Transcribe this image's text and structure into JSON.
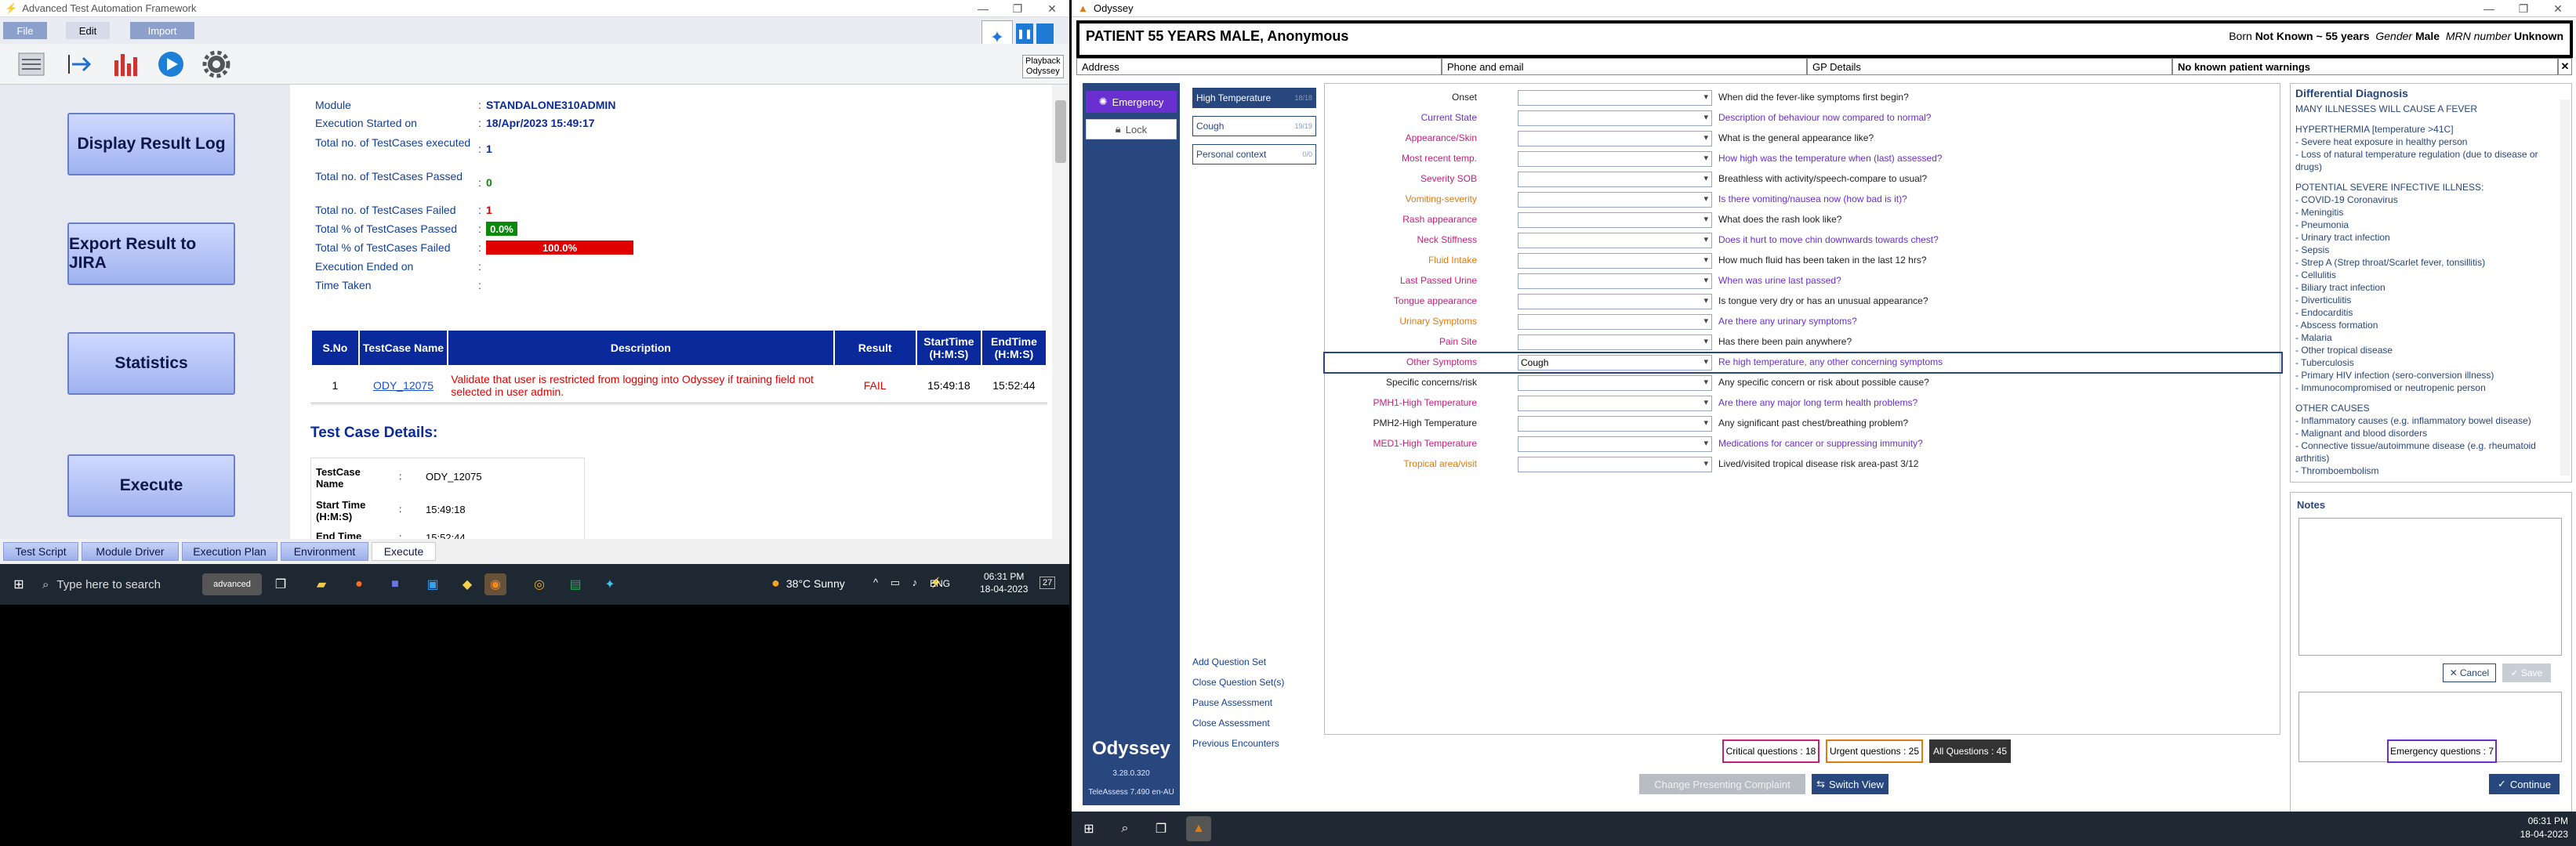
{
  "left": {
    "window_title": "Advanced Test Automation Framework",
    "menu": [
      "File",
      "Edit",
      "Import"
    ],
    "playback": "Playback",
    "playback_app": "Odyssey",
    "buttons": [
      "Display Result Log",
      "Export Result to JIRA",
      "Statistics",
      "Execute"
    ],
    "summary": [
      {
        "label": "Module",
        "value": "STANDALONE310ADMIN"
      },
      {
        "label": "Execution Started on",
        "value": "18/Apr/2023 15:49:17"
      },
      {
        "label": "Total no. of TestCases executed",
        "value": "1"
      },
      {
        "label": "Total no. of TestCases Passed",
        "value": "0"
      },
      {
        "label": "Total no. of TestCases Failed",
        "value": "1"
      },
      {
        "label": "Total % of TestCases Passed",
        "value": "0.0%"
      },
      {
        "label": "Total % of TestCases Failed",
        "value": "100.0%"
      },
      {
        "label": "Execution Ended on",
        "value": ""
      },
      {
        "label": "Time Taken",
        "value": ""
      }
    ],
    "pass_fraction": 0.0,
    "fail_fraction": 1.0,
    "table_headers": [
      "S.No",
      "TestCase Name",
      "Description",
      "Result",
      "StartTime (H:M:S)",
      "EndTime (H:M:S)"
    ],
    "row": {
      "sno": "1",
      "name": "ODY_12075",
      "desc": "Validate that user is restricted from logging into Odyssey if training field not selected in user admin.",
      "result": "FAIL",
      "start": "15:49:18",
      "end": "15:52:44"
    },
    "details_title": "Test Case Details:",
    "details": [
      {
        "label": "TestCase Name",
        "value": "ODY_12075"
      },
      {
        "label": "Start Time (H:M:S)",
        "value": "15:49:18"
      },
      {
        "label": "End Time (H:M:S)",
        "value": "15:52:44"
      }
    ],
    "bottom_tabs": [
      "Test Script",
      "Module Driver",
      "Execution Plan",
      "Environment",
      "Execute"
    ],
    "search_placeholder": "Type here to search",
    "weather": "38°C  Sunny",
    "lang": "ENG",
    "time": "06:31 PM",
    "date": "18-04-2023",
    "notif": "27"
  },
  "right": {
    "window_title": "Odyssey",
    "patient": "PATIENT 55 YEARS MALE, Anonymous",
    "born_label": "Born",
    "born": "Not Known ~ 55 years",
    "gender_label": "Gender",
    "gender": "Male",
    "mrn_label": "MRN number",
    "mrn": "Unknown",
    "address": "Address",
    "phone": "Phone and email",
    "gp": "GP Details",
    "warnings": "No known patient warnings",
    "emergency": "Emergency",
    "lock": "Lock",
    "symptoms": [
      {
        "label": "High Temperature",
        "n": "18/18",
        "active": true
      },
      {
        "label": "Cough",
        "n": "19/19",
        "active": false
      },
      {
        "label": "Personal context",
        "n": "0/0",
        "active": false
      }
    ],
    "questions": [
      {
        "label": "Onset",
        "c": "#222",
        "value": "",
        "text": "When did the fever-like symptoms first begin?",
        "tc": "#222"
      },
      {
        "label": "Current State",
        "c": "#6a2fd1",
        "value": "",
        "text": "Description of behaviour now compared to normal?",
        "tc": "#6a2fd1"
      },
      {
        "label": "Appearance/Skin",
        "c": "#c81e7a",
        "value": "",
        "text": "What is the general appearance like?",
        "tc": "#222"
      },
      {
        "label": "Most recent temp.",
        "c": "#c81e7a",
        "value": "",
        "text": "How high was the temperature when (last) assessed?",
        "tc": "#6a2fd1"
      },
      {
        "label": "Severity SOB",
        "c": "#c81e7a",
        "value": "",
        "text": "Breathless with activity/speech-compare to usual?",
        "tc": "#222"
      },
      {
        "label": "Vomiting-severity",
        "c": "#e07a12",
        "value": "",
        "text": "Is there vomiting/nausea now (how bad is it)?",
        "tc": "#6a2fd1"
      },
      {
        "label": "Rash appearance",
        "c": "#c81e7a",
        "value": "",
        "text": "What does the rash look like?",
        "tc": "#222"
      },
      {
        "label": "Neck Stiffness",
        "c": "#c81e7a",
        "value": "",
        "text": "Does it hurt to move chin downwards towards chest?",
        "tc": "#6a2fd1"
      },
      {
        "label": "Fluid Intake",
        "c": "#e07a12",
        "value": "",
        "text": "How much fluid has been taken in the last 12 hrs?",
        "tc": "#222"
      },
      {
        "label": "Last Passed Urine",
        "c": "#c81e7a",
        "value": "",
        "text": "When was urine last passed?",
        "tc": "#6a2fd1"
      },
      {
        "label": "Tongue appearance",
        "c": "#c81e7a",
        "value": "",
        "text": "Is tongue very dry or has an unusual appearance?",
        "tc": "#222"
      },
      {
        "label": "Urinary Symptoms",
        "c": "#e07a12",
        "value": "",
        "text": "Are there any urinary symptoms?",
        "tc": "#6a2fd1"
      },
      {
        "label": "Pain Site",
        "c": "#c81e7a",
        "value": "",
        "text": "Has there been pain anywhere?",
        "tc": "#222"
      },
      {
        "label": "Other Symptoms",
        "c": "#c81e7a",
        "value": "Cough",
        "text": "Re high temperature, any other concerning symptoms",
        "tc": "#6a2fd1"
      },
      {
        "label": "Specific concerns/risk",
        "c": "#222",
        "value": "",
        "text": "Any specific concern or risk about possible cause?",
        "tc": "#222"
      },
      {
        "label": "PMH1-High Temperature",
        "c": "#c81e7a",
        "value": "",
        "text": "Are there any major long term health problems?",
        "tc": "#6a2fd1"
      },
      {
        "label": "PMH2-High Temperature",
        "c": "#222",
        "value": "",
        "text": "Any significant past chest/breathing problem?",
        "tc": "#222"
      },
      {
        "label": "MED1-High Temperature",
        "c": "#c81e7a",
        "value": "",
        "text": "Medications for cancer or suppressing immunity?",
        "tc": "#6a2fd1"
      },
      {
        "label": "Tropical area/visit",
        "c": "#e07a12",
        "value": "",
        "text": "Lived/visited tropical disease risk area-past 3/12",
        "tc": "#222"
      }
    ],
    "links": [
      "Add Question Set",
      "Close Question Set(s)",
      "Pause Assessment",
      "Close Assessment",
      "Previous Encounters"
    ],
    "brand": "Odyssey",
    "version": "3.28.0.320",
    "teleassess": "TeleAssess 7.490 en-AU",
    "ddx_title": "Differential Diagnosis",
    "ddx": [
      "MANY ILLNESSES WILL CAUSE A FEVER",
      "",
      "HYPERTHERMIA [temperature >41C]",
      "- Severe heat exposure in healthy person",
      "- Loss of natural temperature regulation (due to disease or drugs)",
      "",
      "POTENTIAL SEVERE INFECTIVE ILLNESS:",
      "- COVID-19 Coronavirus",
      "- Meningitis",
      "- Pneumonia",
      "- Urinary tract infection",
      "- Sepsis",
      "- Strep A (Strep throat/Scarlet fever, tonsillitis)",
      "- Cellulitis",
      "- Biliary tract infection",
      "- Diverticulitis",
      "- Endocarditis",
      "- Abscess formation",
      "- Malaria",
      "- Other tropical disease",
      "- Tuberculosis",
      "- Primary HIV infection (sero-conversion illness)",
      "- Immunocompromised or neutropenic person",
      "",
      "OTHER CAUSES",
      "- Inflammatory causes (e.g. inflammatory bowel disease)",
      "- Malignant and blood disorders",
      "- Connective tissue/autoimmune disease (e.g. rheumatoid arthritis)",
      "- Thromboembolism"
    ],
    "notes": "Notes",
    "cancel": "Cancel",
    "save": "Save",
    "counts": [
      {
        "label": "Emergency questions : 7",
        "c": "#6a2fd1"
      },
      {
        "label": "Critical questions : 18",
        "c": "#c81e7a"
      },
      {
        "label": "Urgent questions : 25",
        "c": "#e07a12"
      },
      {
        "label": "All Questions : 45",
        "c": "#222"
      }
    ],
    "change": "Change Presenting Complaint",
    "switch": "Switch View",
    "continue": "Continue",
    "time": "06:31 PM",
    "date": "18-04-2023"
  },
  "colors": {
    "navy": "#28477e",
    "report_blue": "#0a2a9c",
    "fail": "#e00000",
    "pass": "#0a8a0a",
    "purple": "#6a2fd1"
  }
}
